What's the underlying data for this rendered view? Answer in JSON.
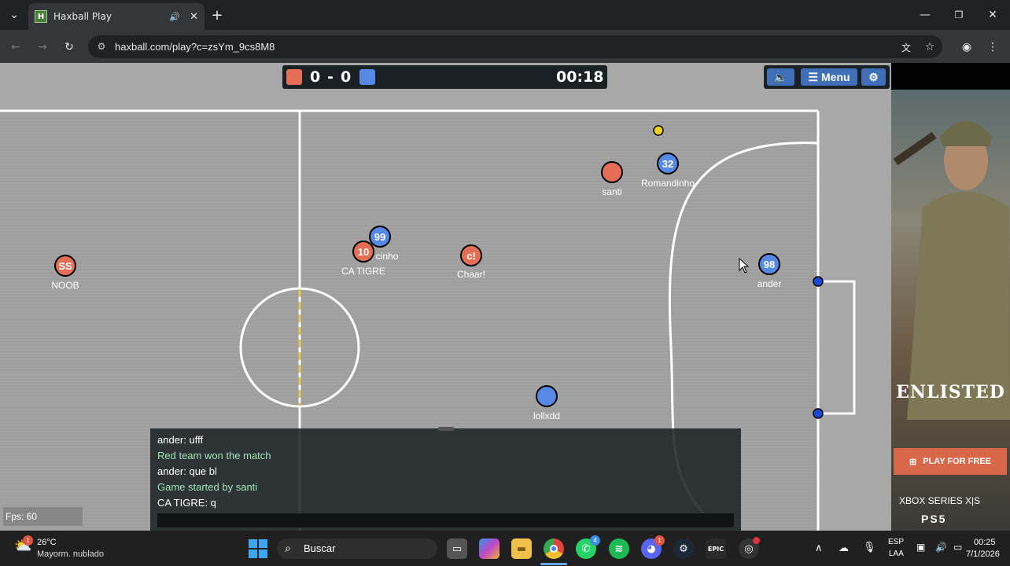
{
  "browser": {
    "tab_title": "Haxball Play",
    "tab_favicon": "H",
    "url": "haxball.com/play?c=zsYm_9cs8M8"
  },
  "scoreboard": {
    "red_score": "0",
    "separator": "-",
    "blue_score": "0",
    "time": "00:18",
    "red_color": "#e56e56",
    "blue_color": "#5689e5"
  },
  "controls": {
    "sound_icon": "speaker-icon",
    "menu_label": "Menu",
    "settings_icon": "gear-icon"
  },
  "players": [
    {
      "team": "red",
      "avatar": "SS",
      "name": "NOOB"
    },
    {
      "team": "red",
      "avatar": "10",
      "name": "CA TIGRE"
    },
    {
      "team": "blue",
      "avatar": "99",
      "name": "cinho"
    },
    {
      "team": "red",
      "avatar": "c!",
      "name": "Chaar!"
    },
    {
      "team": "red",
      "avatar": "",
      "name": "santi"
    },
    {
      "team": "blue",
      "avatar": "32",
      "name": "Romandinho"
    },
    {
      "team": "blue",
      "avatar": "98",
      "name": "ander"
    },
    {
      "team": "blue",
      "avatar": "",
      "name": "lollxdd"
    }
  ],
  "chat": [
    {
      "text": "ander: ufff",
      "system": false
    },
    {
      "text": "Red team won the match",
      "system": true
    },
    {
      "text": "ander: que bl",
      "system": false
    },
    {
      "text": "Game started by santi",
      "system": true
    },
    {
      "text": "CA TIGRE: q",
      "system": false
    }
  ],
  "fps": "Fps: 60",
  "ad": {
    "brand": "ENLISTED",
    "cta": "PLAY FOR FREE",
    "platform1": "XBOX SERIES X|S",
    "platform2": "PS5"
  },
  "taskbar": {
    "weather_temp": "26°C",
    "weather_desc": "Mayorm. nublado",
    "weather_badge": "1",
    "search_label": "Buscar",
    "lang_top": "ESP",
    "lang_bottom": "LAA",
    "time": "00:25",
    "date": "7/1/2026",
    "whatsapp_badge": "4",
    "discord_badge": "1"
  }
}
